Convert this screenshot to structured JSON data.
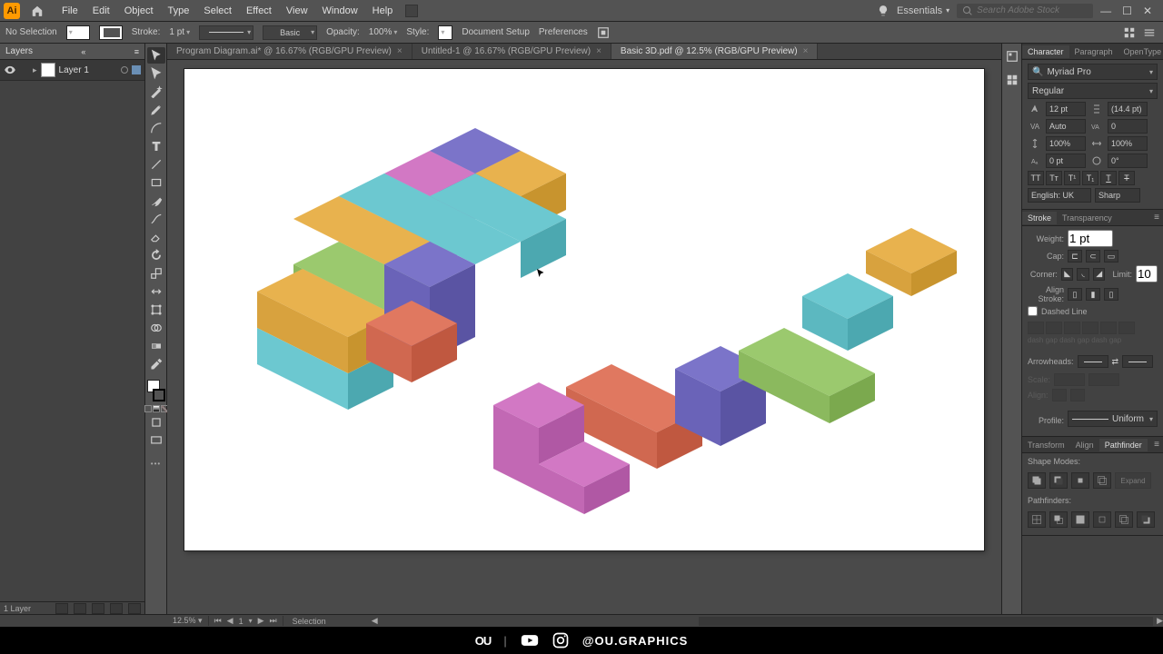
{
  "menu": {
    "items": [
      "File",
      "Edit",
      "Object",
      "Type",
      "Select",
      "Effect",
      "View",
      "Window",
      "Help"
    ],
    "workspace": "Essentials",
    "search_placeholder": "Search Adobe Stock"
  },
  "control": {
    "no_selection": "No Selection",
    "stroke_label": "Stroke:",
    "stroke_weight": "1 pt",
    "variable_width_profile": "Uniform",
    "brush_definition": "Basic",
    "opacity_label": "Opacity:",
    "opacity_value": "100%",
    "style_label": "Style:",
    "document_setup": "Document Setup",
    "preferences": "Preferences"
  },
  "layers": {
    "panel_title": "Layers",
    "items": [
      {
        "name": "Layer 1"
      }
    ],
    "footer": "1 Layer"
  },
  "tabs": [
    {
      "label": "Program Diagram.ai* @ 16.67% (RGB/GPU Preview)",
      "active": false
    },
    {
      "label": "Untitled-1 @ 16.67% (RGB/GPU Preview)",
      "active": false
    },
    {
      "label": "Basic 3D.pdf @ 12.5% (RGB/GPU Preview)",
      "active": true
    }
  ],
  "status": {
    "zoom": "12.5%",
    "artboard_nav": "1",
    "tool": "Selection"
  },
  "char_panel": {
    "tabs": [
      "Character",
      "Paragraph",
      "OpenType"
    ],
    "font_family": "Myriad Pro",
    "font_style": "Regular",
    "font_size": "12 pt",
    "leading": "(14.4 pt)",
    "kerning": "Auto",
    "tracking": "0",
    "vscale": "100%",
    "hscale": "100%",
    "baseline": "0 pt",
    "rotation": "0°",
    "language": "English: UK",
    "antialias": "Sharp"
  },
  "stroke_panel": {
    "tabs": [
      "Stroke",
      "Transparency"
    ],
    "weight_label": "Weight:",
    "weight": "1 pt",
    "cap_label": "Cap:",
    "corner_label": "Corner:",
    "limit_label": "Limit:",
    "limit": "10",
    "align_label": "Align Stroke:",
    "dashed_label": "Dashed Line",
    "arrowheads_label": "Arrowheads:",
    "profile_label": "Profile:",
    "profile": "Uniform"
  },
  "pathfinder_panel": {
    "tabs": [
      "Transform",
      "Align",
      "Pathfinder"
    ],
    "shape_modes": "Shape Modes:",
    "pathfinders": "Pathfinders:",
    "expand": "Expand"
  },
  "footer": {
    "brand": "OU",
    "handle": "@OU.GRAPHICS"
  }
}
